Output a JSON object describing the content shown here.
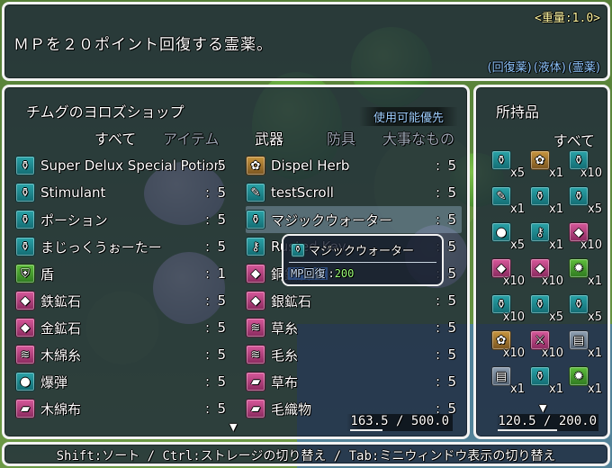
{
  "help": {
    "weight": "<重量:1.0>",
    "description": "ＭＰを２０ポイント回復する霊薬。",
    "tags": [
      "(回復薬)",
      "(液体)",
      "(霊薬)"
    ]
  },
  "shop": {
    "title": "チムグのヨロズショップ",
    "priority_label": "使用可能優先",
    "categories": [
      {
        "label": "すべて",
        "active": true
      },
      {
        "label": "アイテム",
        "active": false
      },
      {
        "label": "武器",
        "active": true
      },
      {
        "label": "防具",
        "active": false
      },
      {
        "label": "大事なもの",
        "active": false
      }
    ],
    "left_items": [
      {
        "name": "Super Delux Special Potion",
        "qty": "5",
        "icon": "potion-icon",
        "glyph": "⚱",
        "color": "teal"
      },
      {
        "name": "Stimulant",
        "qty": "5",
        "icon": "potion-icon",
        "glyph": "⚱",
        "color": "teal"
      },
      {
        "name": "ポーション",
        "qty": "5",
        "icon": "potion-icon",
        "glyph": "⚱",
        "color": "teal"
      },
      {
        "name": "まじっくうぉーたー",
        "qty": "5",
        "icon": "potion-icon",
        "glyph": "⚱",
        "color": "teal"
      },
      {
        "name": "盾",
        "qty": "1",
        "icon": "shield-icon",
        "glyph": "⛨",
        "color": "green"
      },
      {
        "name": "鉄鉱石",
        "qty": "5",
        "icon": "ore-icon",
        "glyph": "◆",
        "color": "pink"
      },
      {
        "name": "金鉱石",
        "qty": "5",
        "icon": "ore-icon",
        "glyph": "◆",
        "color": "pink"
      },
      {
        "name": "木綿糸",
        "qty": "5",
        "icon": "thread-icon",
        "glyph": "≋",
        "color": "pink"
      },
      {
        "name": "爆弾",
        "qty": "5",
        "icon": "bomb-icon",
        "glyph": "●",
        "color": "teal"
      },
      {
        "name": "木綿布",
        "qty": "5",
        "icon": "cloth-icon",
        "glyph": "▰",
        "color": "pink"
      }
    ],
    "right_items": [
      {
        "name": "Dispel Herb",
        "qty": "5",
        "icon": "herb-icon",
        "glyph": "✿",
        "color": "brown"
      },
      {
        "name": "testScroll",
        "qty": "5",
        "icon": "scroll-icon",
        "glyph": "✎",
        "color": "teal"
      },
      {
        "name": "マジックウォーター",
        "qty": "5",
        "icon": "potion-icon",
        "glyph": "⚱",
        "color": "teal",
        "selected": true
      },
      {
        "name": "Rusted Key",
        "qty": "5",
        "icon": "key-icon",
        "glyph": "⚷",
        "color": "teal"
      },
      {
        "name": "銅鉱石",
        "qty": "5",
        "icon": "ore-icon",
        "glyph": "◆",
        "color": "pink"
      },
      {
        "name": "銀鉱石",
        "qty": "5",
        "icon": "ore-icon",
        "glyph": "◆",
        "color": "pink"
      },
      {
        "name": "草糸",
        "qty": "5",
        "icon": "thread-icon",
        "glyph": "≋",
        "color": "pink"
      },
      {
        "name": "毛糸",
        "qty": "5",
        "icon": "yarn-icon",
        "glyph": "≋",
        "color": "pink"
      },
      {
        "name": "草布",
        "qty": "5",
        "icon": "cloth-icon",
        "glyph": "▰",
        "color": "pink"
      },
      {
        "name": "毛織物",
        "qty": "5",
        "icon": "cloth-icon",
        "glyph": "▰",
        "color": "pink"
      }
    ],
    "money": "163.5 / 500.0",
    "money_fill": 0.327,
    "scroll_arrow": "▼"
  },
  "tooltip": {
    "title": "マジックウォーター",
    "stat_label": "MP回復",
    "stat_colon": ":",
    "stat_value": "200"
  },
  "inventory": {
    "title": "所持品",
    "category": "すべて",
    "items": [
      {
        "icon": "potion-icon",
        "glyph": "⚱",
        "color": "teal",
        "count": "x5"
      },
      {
        "icon": "herb-icon",
        "glyph": "✿",
        "color": "brown",
        "count": "x1"
      },
      {
        "icon": "potion-icon",
        "glyph": "⚱",
        "color": "teal",
        "count": "x10"
      },
      {
        "icon": "scroll-icon",
        "glyph": "✎",
        "color": "teal",
        "count": "x1"
      },
      {
        "icon": "potion-icon",
        "glyph": "⚱",
        "color": "teal",
        "count": "x1"
      },
      {
        "icon": "potion-icon",
        "glyph": "⚱",
        "color": "teal",
        "count": "x5"
      },
      {
        "icon": "bomb-icon",
        "glyph": "●",
        "color": "teal",
        "count": "x5"
      },
      {
        "icon": "key-icon",
        "glyph": "⚷",
        "color": "teal",
        "count": "x1"
      },
      {
        "icon": "ore-icon",
        "glyph": "◆",
        "color": "pink",
        "count": "x10"
      },
      {
        "icon": "ore-icon",
        "glyph": "◆",
        "color": "pink",
        "count": "x10"
      },
      {
        "icon": "ore-icon",
        "glyph": "◆",
        "color": "pink",
        "count": "x10"
      },
      {
        "icon": "gear-icon",
        "glyph": "✹",
        "color": "green",
        "count": "x1"
      },
      {
        "icon": "potion-icon",
        "glyph": "⚱",
        "color": "teal",
        "count": "x10"
      },
      {
        "icon": "potion-icon",
        "glyph": "⚱",
        "color": "teal",
        "count": "x5"
      },
      {
        "icon": "potion-icon",
        "glyph": "⚱",
        "color": "teal",
        "count": "x5"
      },
      {
        "icon": "herb-icon",
        "glyph": "✿",
        "color": "brown",
        "count": "x10"
      },
      {
        "icon": "sword-icon",
        "glyph": "⚔",
        "color": "pink",
        "count": "x10"
      },
      {
        "icon": "book-icon",
        "glyph": "▤",
        "color": "grey",
        "count": "x1"
      },
      {
        "icon": "book-icon",
        "glyph": "▤",
        "color": "grey",
        "count": "x1"
      },
      {
        "icon": "potion-icon",
        "glyph": "⚱",
        "color": "teal",
        "count": "x1"
      },
      {
        "icon": "gear-icon",
        "glyph": "✹",
        "color": "green",
        "count": "x1"
      }
    ],
    "scroll_arrow": "▼",
    "money": "120.5 / 200.0",
    "money_fill": 0.6025
  },
  "footer": {
    "hint": "Shift:ソート / Ctrl:ストレージの切り替え / Tab:ミニウィンドウ表示の切り替え"
  },
  "colors": {
    "window_bg": "#1c263a",
    "border": "#f2f2f2",
    "tag_blue": "#8fc6ff",
    "weight_yellow": "#fff6a0",
    "stat_green": "#9cff7a"
  }
}
